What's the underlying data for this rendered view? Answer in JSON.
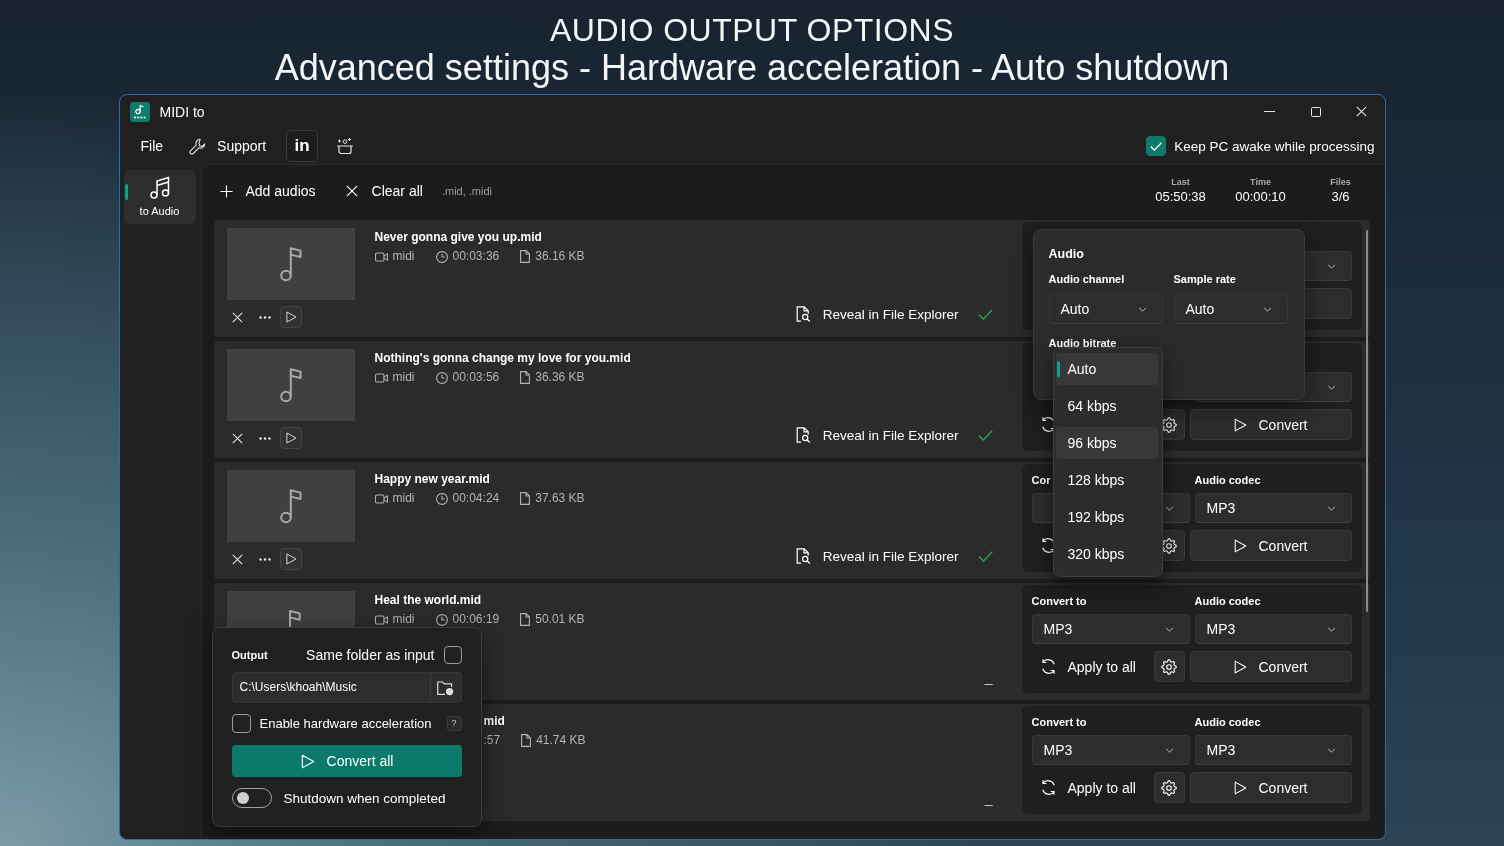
{
  "promo": {
    "title": "AUDIO OUTPUT OPTIONS",
    "subtitle": "Advanced settings - Hardware acceleration - Auto shutdown"
  },
  "window": {
    "title": "MIDI to"
  },
  "menu": {
    "file": "File",
    "support": "Support",
    "social": "in"
  },
  "keep_awake": {
    "label": "Keep PC awake while processing",
    "checked": true
  },
  "nav": [
    {
      "label": "to Audio",
      "selected": true
    }
  ],
  "toolbar": {
    "add": "Add audios",
    "clear": "Clear all",
    "extensions": ".mid, .midi"
  },
  "stats": [
    {
      "label": "Last",
      "value": "05:50:38"
    },
    {
      "label": "Time",
      "value": "00:00:10"
    },
    {
      "label": "Files",
      "value": "3/6"
    }
  ],
  "rows": [
    {
      "title": "Never gonna give you up.mid",
      "type": "midi",
      "duration": "00:03:36",
      "size": "36.16 KB",
      "result": {
        "kind": "done",
        "label": "Reveal in File Explorer"
      }
    },
    {
      "title": "Nothing's gonna change my love for you.mid",
      "type": "midi",
      "duration": "00:03:56",
      "size": "36.36 KB",
      "result": {
        "kind": "done",
        "label": "Reveal in File Explorer"
      },
      "panel": {
        "convert": "Convert"
      }
    },
    {
      "title": "Happy new year.mid",
      "type": "midi",
      "duration": "00:04:24",
      "size": "37.63 KB",
      "result": {
        "kind": "done",
        "label": "Reveal in File Explorer"
      },
      "panel": {
        "format_label": "Cor",
        "codec_label": "Audio codec",
        "codec": "MP3",
        "convert": "Convert"
      }
    },
    {
      "title": "Heal the world.mid",
      "type": "midi",
      "duration": "00:06:19",
      "size": "50.01 KB",
      "result": {
        "kind": "pending",
        "label": "_"
      },
      "panel": {
        "format_label": "Convert to",
        "format": "MP3",
        "codec_label": "Audio codec",
        "codec": "MP3",
        "apply": "Apply to all",
        "convert": "Convert"
      }
    },
    {
      "title": "mid",
      "duration": ":57",
      "size": "41.74 KB",
      "result": {
        "kind": "pending",
        "label": "_"
      },
      "panel": {
        "format_label": "Convert to",
        "format": "MP3",
        "codec_label": "Audio codec",
        "codec": "MP3",
        "apply": "Apply to all",
        "convert": "Convert"
      }
    }
  ],
  "audio_settings": {
    "title": "Audio",
    "channel_label": "Audio channel",
    "channel": "Auto",
    "rate_label": "Sample rate",
    "rate": "Auto",
    "bitrate_label": "Audio bitrate",
    "bitrate_options": [
      {
        "label": "Auto",
        "selected": true,
        "hovered": false
      },
      {
        "label": "64 kbps",
        "selected": false,
        "hovered": false
      },
      {
        "label": "96 kbps",
        "selected": false,
        "hovered": true
      },
      {
        "label": "128 kbps",
        "selected": false,
        "hovered": false
      },
      {
        "label": "192 kbps",
        "selected": false,
        "hovered": false
      },
      {
        "label": "320 kbps",
        "selected": false,
        "hovered": false
      }
    ]
  },
  "output": {
    "label": "Output",
    "same_folder_label": "Same folder as input",
    "same_folder": false,
    "path": "C:\\Users\\khoah\\Music",
    "hardware_label": "Enable hardware acceleration",
    "hardware_acceleration": false,
    "help": "?",
    "convert_all": "Convert all",
    "shutdown_label": "Shutdown when completed",
    "shutdown": false
  }
}
